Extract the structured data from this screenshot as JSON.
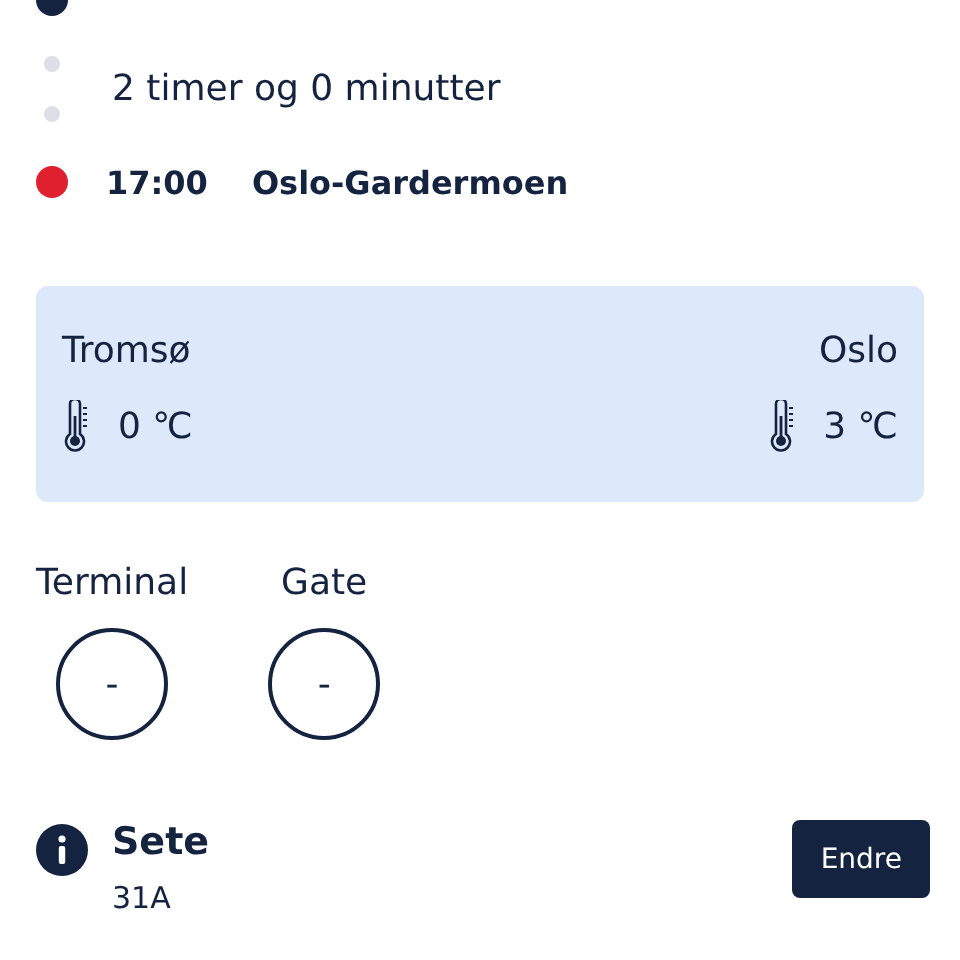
{
  "route": {
    "stops": [
      {
        "color": "#14233f"
      },
      {
        "duration": "2 timer og 0 minutter"
      },
      {
        "color": "#e0202e",
        "time": "17:00",
        "place": "Oslo-Gardermoen"
      }
    ]
  },
  "weather": {
    "origin": {
      "city": "Tromsø",
      "temp": "0 ℃"
    },
    "destination": {
      "city": "Oslo",
      "temp": "3 ℃"
    }
  },
  "info": [
    {
      "label": "Terminal",
      "value": "-"
    },
    {
      "label": "Gate",
      "value": "-"
    }
  ],
  "seat": {
    "label": "Sete",
    "value": "31A",
    "button": "Endre"
  }
}
